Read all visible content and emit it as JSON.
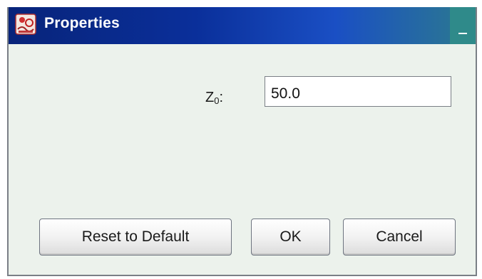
{
  "window": {
    "title": "Properties",
    "icon": "app-icon"
  },
  "form": {
    "z0_label_main": "Z",
    "z0_label_sub": "0",
    "z0_label_colon": ":",
    "z0_value": "50.0"
  },
  "buttons": {
    "reset_label": "Reset to Default",
    "ok_label": "OK",
    "cancel_label": "Cancel"
  },
  "colors": {
    "titlebar_start": "#08247a",
    "titlebar_end": "#2c7a8e",
    "dialog_background": "#ecf2ec"
  }
}
